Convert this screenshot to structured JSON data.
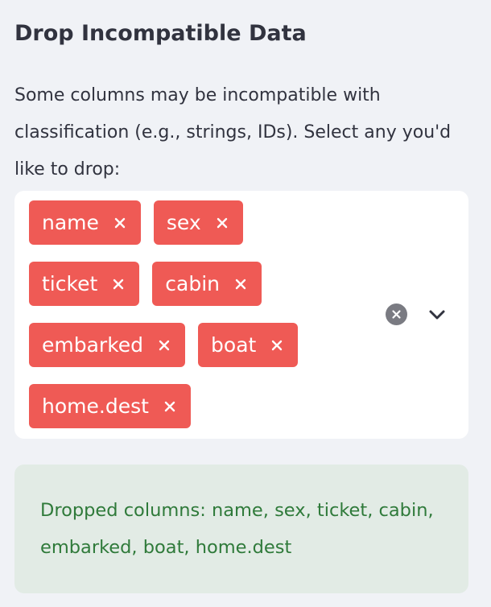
{
  "section": {
    "title": "Drop Incompatible Data",
    "description": "Some columns may be incompatible with classification (e.g., strings, IDs). Select any you'd like to drop:"
  },
  "multiselect": {
    "selected": [
      "name",
      "sex",
      "ticket",
      "cabin",
      "embarked",
      "boat",
      "home.dest"
    ],
    "remove_icon": "close-icon",
    "clear_icon": "clear-circle-icon",
    "dropdown_icon": "chevron-down-icon"
  },
  "alert": {
    "message": "Dropped columns: name, sex, ticket, cabin, embarked, boat, home.dest"
  },
  "colors": {
    "background": "#f0f2f6",
    "tag": "#ef5a55",
    "success_bg": "#e2ebe5",
    "success_text": "#2f7a3a",
    "text": "#31333f"
  }
}
